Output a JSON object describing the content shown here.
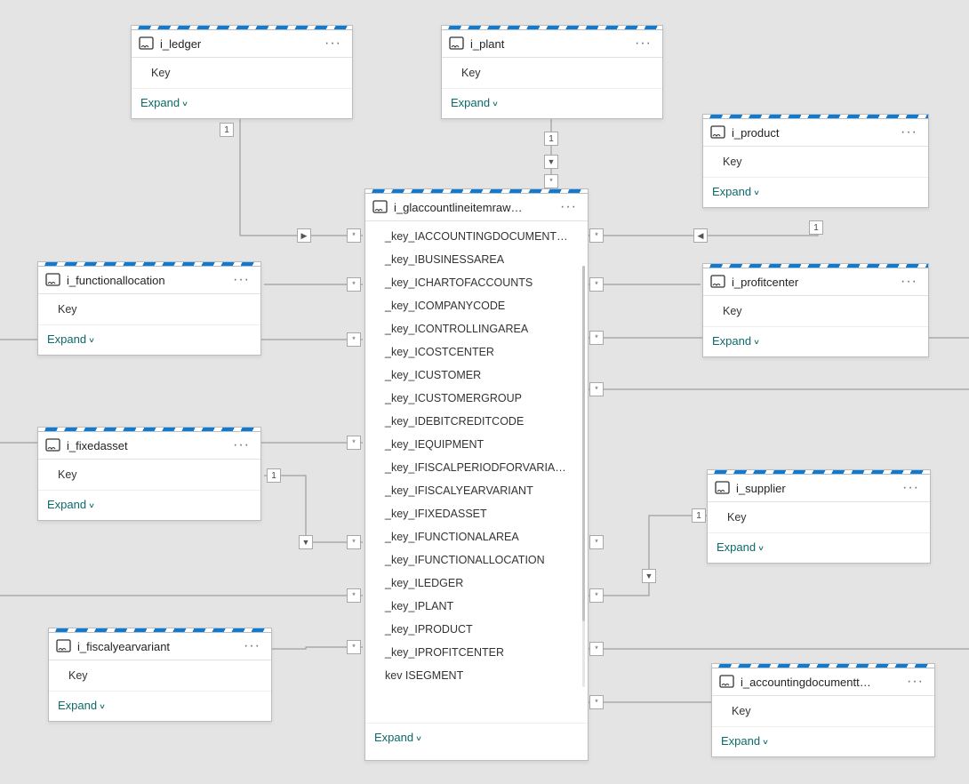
{
  "expand_label": "Expand",
  "more_label": "···",
  "key_label": "Key",
  "nodes": {
    "ledger": {
      "title": "i_ledger"
    },
    "plant": {
      "title": "i_plant"
    },
    "product": {
      "title": "i_product"
    },
    "funcalloc": {
      "title": "i_functionallocation"
    },
    "center": {
      "title": "i_glaccountlineitemraw…"
    },
    "profitcenter": {
      "title": "i_profitcenter"
    },
    "fixedasset": {
      "title": "i_fixedasset"
    },
    "supplier": {
      "title": "i_supplier"
    },
    "fiscal": {
      "title": "i_fiscalyearvariant"
    },
    "acctdoc": {
      "title": "i_accountingdocumentt…"
    }
  },
  "center_fields": [
    "_key_IACCOUNTINGDOCUMENTT…",
    "_key_IBUSINESSAREA",
    "_key_ICHARTOFACCOUNTS",
    "_key_ICOMPANYCODE",
    "_key_ICONTROLLINGAREA",
    "_key_ICOSTCENTER",
    "_key_ICUSTOMER",
    "_key_ICUSTOMERGROUP",
    "_key_IDEBITCREDITCODE",
    "_key_IEQUIPMENT",
    "_key_IFISCALPERIODFORVARIANT",
    "_key_IFISCALYEARVARIANT",
    "_key_IFIXEDASSET",
    "_key_IFUNCTIONALAREA",
    "_key_IFUNCTIONALLOCATION",
    "_key_ILEDGER",
    "_key_IPLANT",
    "_key_IPRODUCT",
    "_key_IPROFITCENTER",
    " kev  ISEGMENT"
  ],
  "cardinality": {
    "one": "1",
    "many": "*"
  }
}
